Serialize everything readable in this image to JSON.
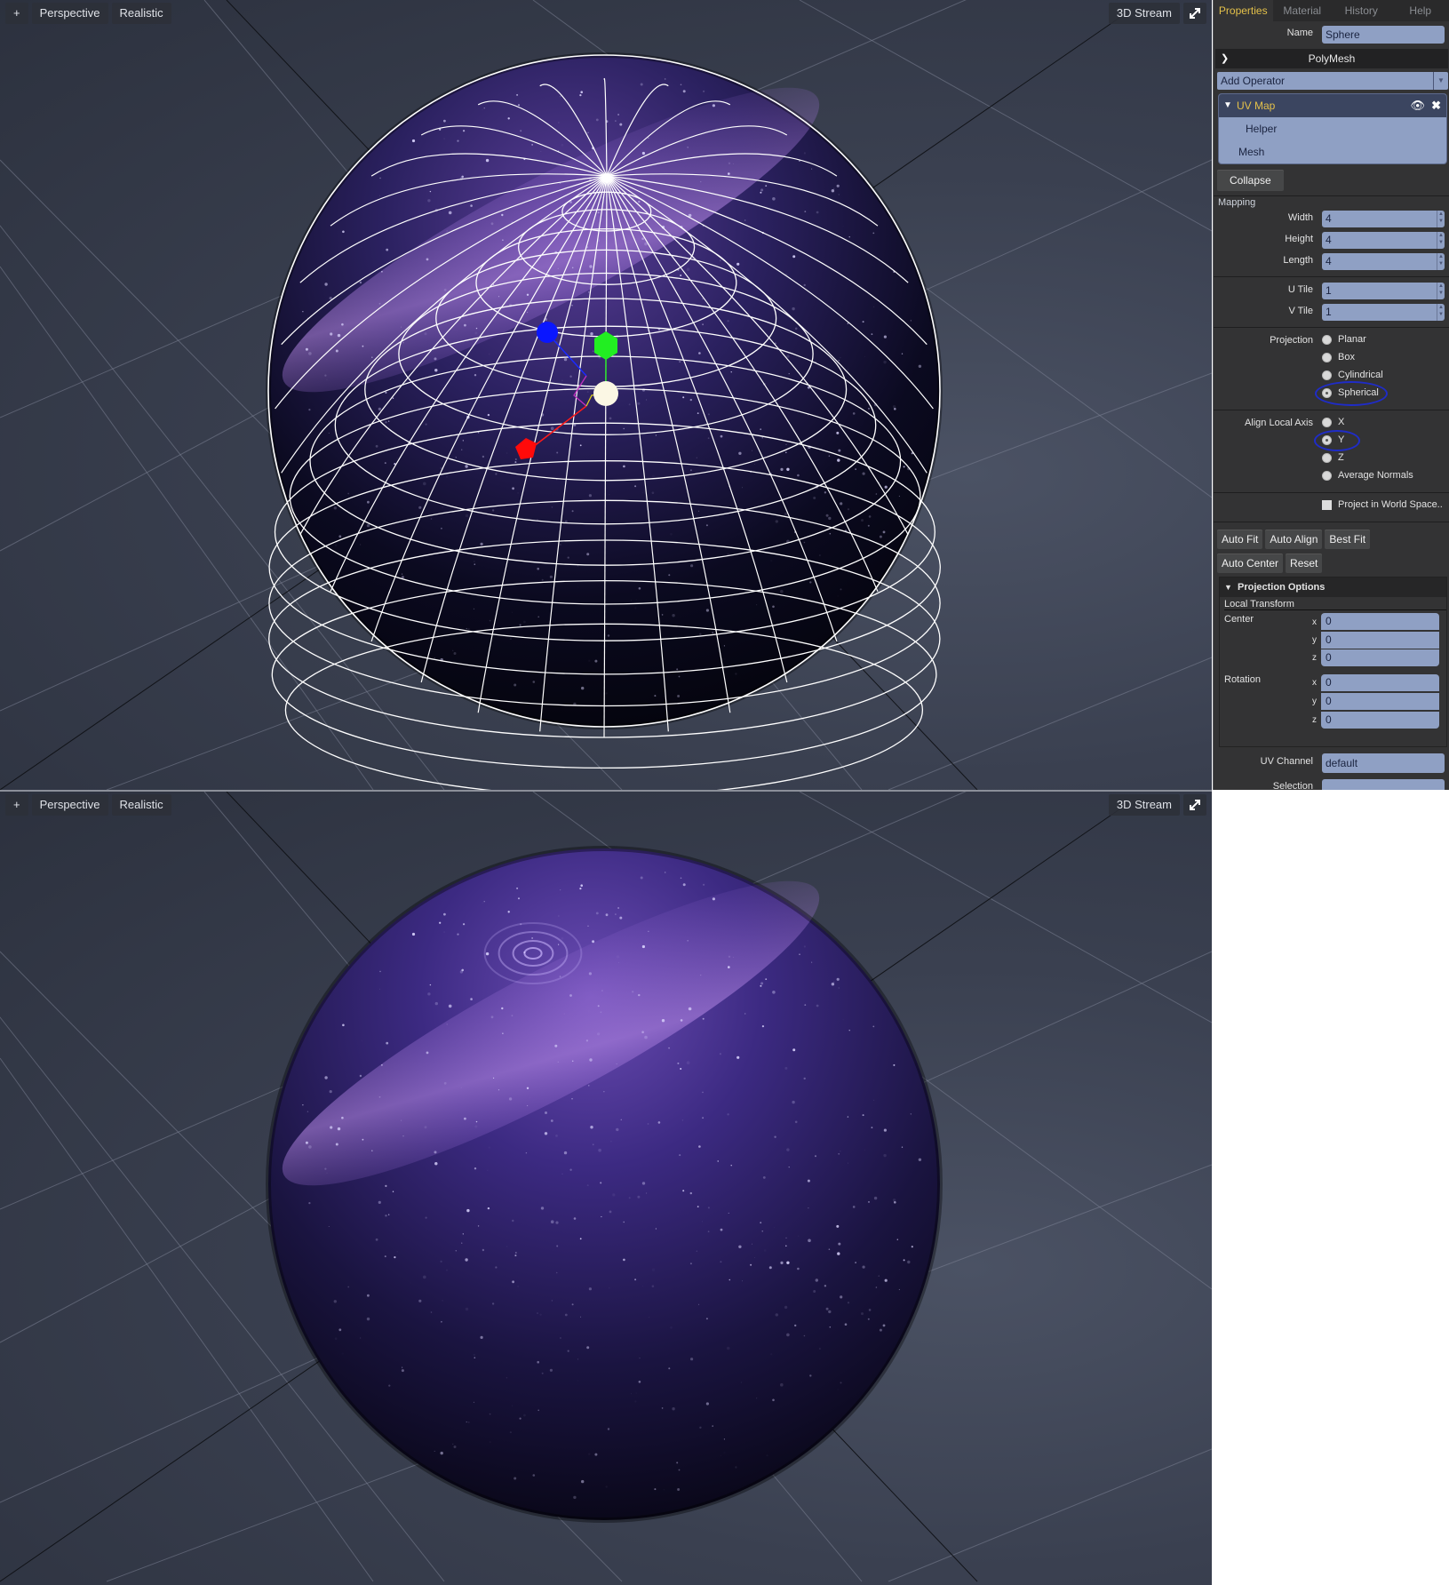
{
  "viewports": [
    {
      "id": "top",
      "toolbar": {
        "add_label": "+",
        "camera_label": "Perspective",
        "shading_label": "Realistic",
        "stream_label": "3D Stream",
        "expand_icon": "expand-icon"
      },
      "object": {
        "type": "sphere",
        "wireframe": true,
        "texture": "purple galaxy",
        "gizmo": true
      }
    },
    {
      "id": "bottom",
      "toolbar": {
        "add_label": "+",
        "camera_label": "Perspective",
        "shading_label": "Realistic",
        "stream_label": "3D Stream",
        "expand_icon": "expand-icon"
      },
      "object": {
        "type": "sphere",
        "wireframe": false,
        "texture": "purple galaxy",
        "gizmo": false
      }
    }
  ],
  "panel": {
    "tabs": [
      {
        "label": "Properties",
        "active": true
      },
      {
        "label": "Material",
        "active": false
      },
      {
        "label": "History",
        "active": false
      },
      {
        "label": "Help",
        "active": false
      }
    ],
    "name_label": "Name",
    "name_value": "Sphere",
    "polymesh_header": "PolyMesh",
    "add_operator": "Add Operator",
    "operators": [
      {
        "label": "UV Map",
        "selected": true
      },
      {
        "label": "Helper",
        "selected": false
      },
      {
        "label": "Mesh",
        "selected": false
      }
    ],
    "collapse_label": "Collapse",
    "mapping_title": "Mapping",
    "width_label": "Width",
    "width_value": "4",
    "height_label": "Height",
    "height_value": "4",
    "length_label": "Length",
    "length_value": "4",
    "utile_label": "U Tile",
    "utile_value": "1",
    "vtile_label": "V Tile",
    "vtile_value": "1",
    "projection_label": "Projection",
    "projection_options": [
      "Planar",
      "Box",
      "Cylindrical",
      "Spherical"
    ],
    "projection_selected": "Spherical",
    "align_label": "Align Local Axis",
    "align_options": [
      "X",
      "Y",
      "Z",
      "Average Normals"
    ],
    "align_selected": "Y",
    "world_space_label": "Project in World Space..",
    "world_space_checked": false,
    "buttons_row1": [
      "Auto Fit",
      "Auto Align",
      "Best Fit"
    ],
    "buttons_row2": [
      "Auto Center",
      "Reset"
    ],
    "projection_options_header": "Projection Options",
    "local_transform_title": "Local Transform",
    "center_label": "Center",
    "center": {
      "x": "0",
      "y": "0",
      "z": "0"
    },
    "rotation_label": "Rotation",
    "rotation": {
      "x": "0",
      "y": "0",
      "z": "0"
    },
    "uv_channel_label": "UV Channel",
    "uv_channel_value": "default",
    "selection_label": "Selection",
    "selection_value": ""
  },
  "colors": {
    "accent": "#e4c14a",
    "field_bg": "#8fa0c4",
    "panel_bg": "#333334",
    "annotation": "#1f2cc8",
    "gizmo_x": "#ff0000",
    "gizmo_y": "#00e000",
    "gizmo_z": "#0010ff"
  }
}
